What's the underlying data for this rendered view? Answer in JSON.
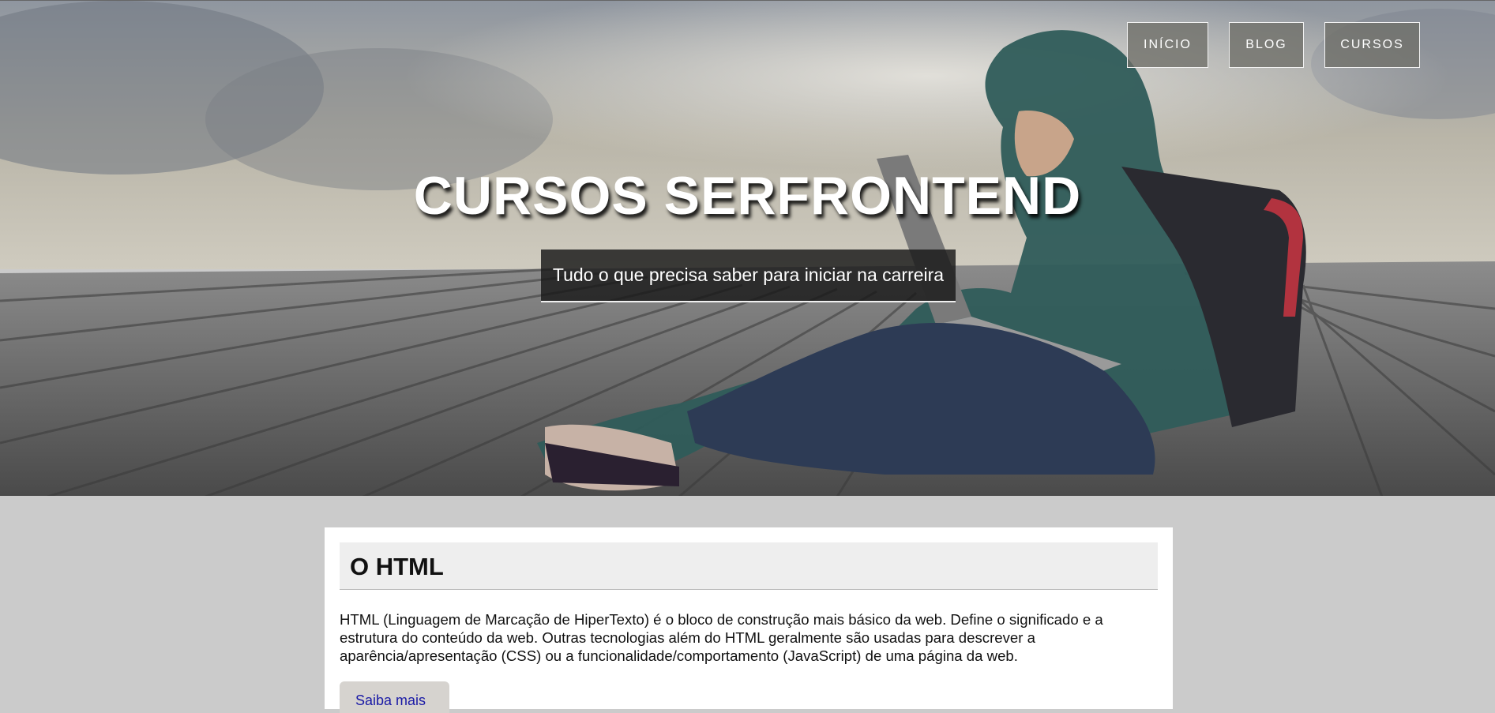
{
  "nav": {
    "items": [
      {
        "label": "INÍCIO"
      },
      {
        "label": "BLOG"
      },
      {
        "label": "CURSOS"
      }
    ]
  },
  "hero": {
    "title": "CURSOS SERFRONTEND",
    "subtitle": "Tudo o que precisa saber para iniciar na carreira"
  },
  "section": {
    "heading": "O HTML",
    "body": "HTML (Linguagem de Marcação de HiperTexto) é o bloco de construção mais básico da web. Define o significado e a estrutura do conteúdo da web. Outras tecnologias além do HTML geralmente são usadas para descrever a aparência/apresentação (CSS) ou a funcionalidade/comportamento (JavaScript) de uma página da web.",
    "button_label": "Saiba mais"
  }
}
